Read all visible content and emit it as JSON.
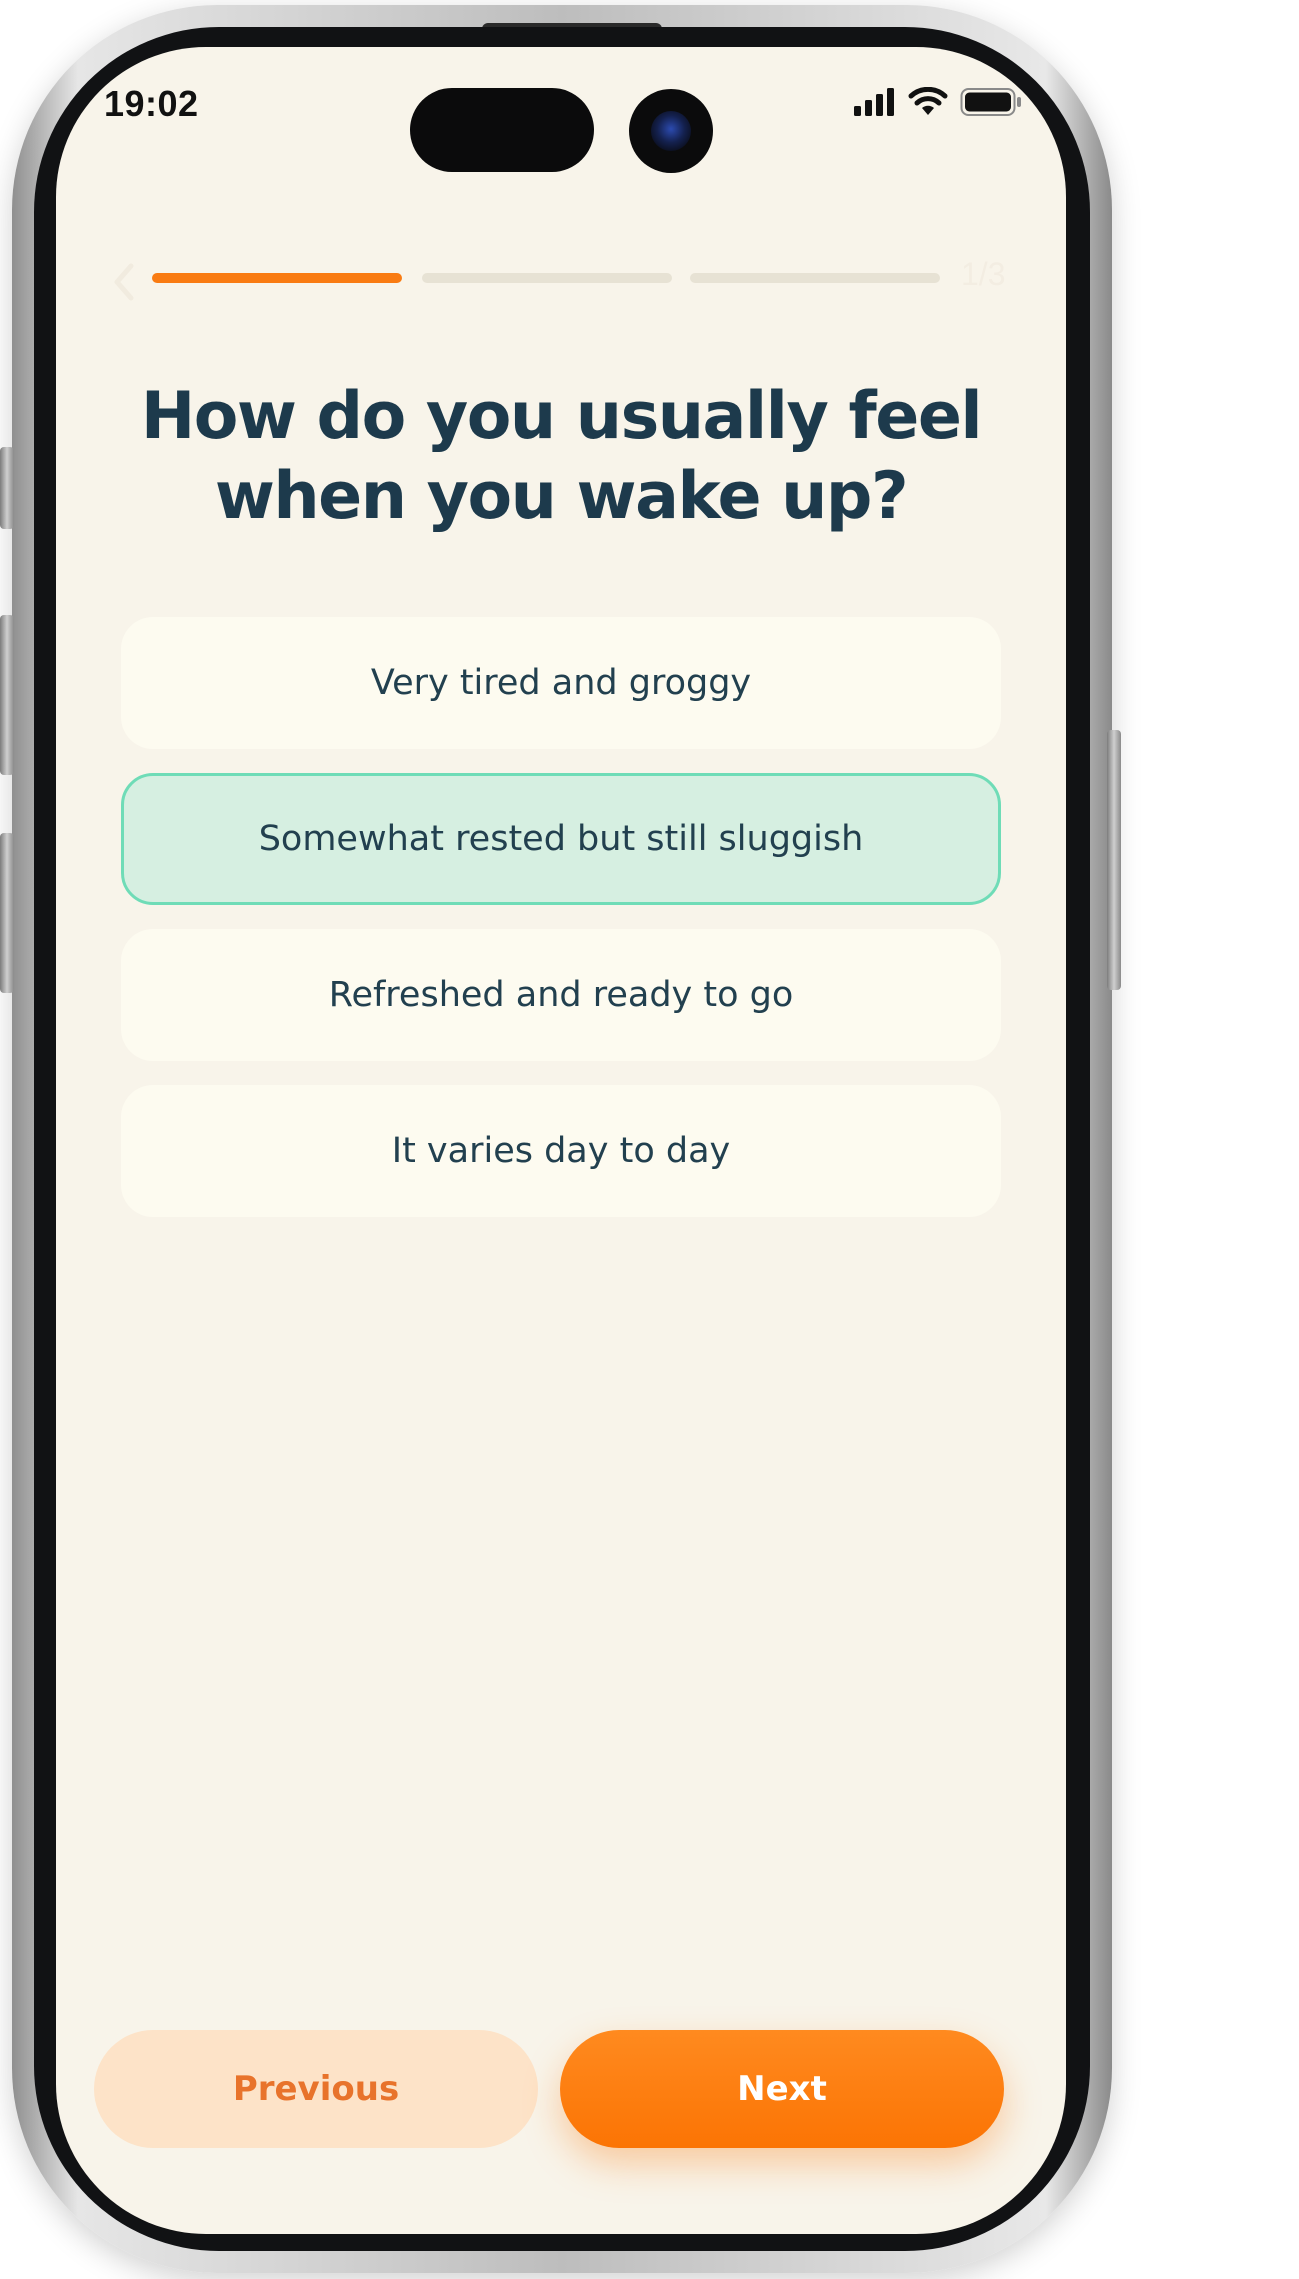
{
  "status_bar": {
    "time": "19:02",
    "icons": [
      "signal-icon",
      "wifi-icon",
      "battery-icon"
    ]
  },
  "quiz": {
    "back_icon": "chevron-left-icon",
    "progress": {
      "current_step": 1,
      "total_steps": 3,
      "label": "1/3"
    },
    "question": "How do you usually feel when you wake up?",
    "options": [
      {
        "label": "Very tired and groggy",
        "selected": false
      },
      {
        "label": "Somewhat rested but still sluggish",
        "selected": true
      },
      {
        "label": "Refreshed and ready to go",
        "selected": false
      },
      {
        "label": "It varies day to day",
        "selected": false
      }
    ]
  },
  "footer": {
    "previous_label": "Previous",
    "next_label": "Next"
  },
  "colors": {
    "background": "#f8f4ea",
    "accent": "#f97b12",
    "title_text": "#1d3a4c",
    "option_background": "#fdfbf0",
    "selected_background": "#d6efe1",
    "selected_border": "#6fdcb7",
    "previous_button_background": "#fde3c8",
    "previous_button_text": "#e8732b"
  }
}
